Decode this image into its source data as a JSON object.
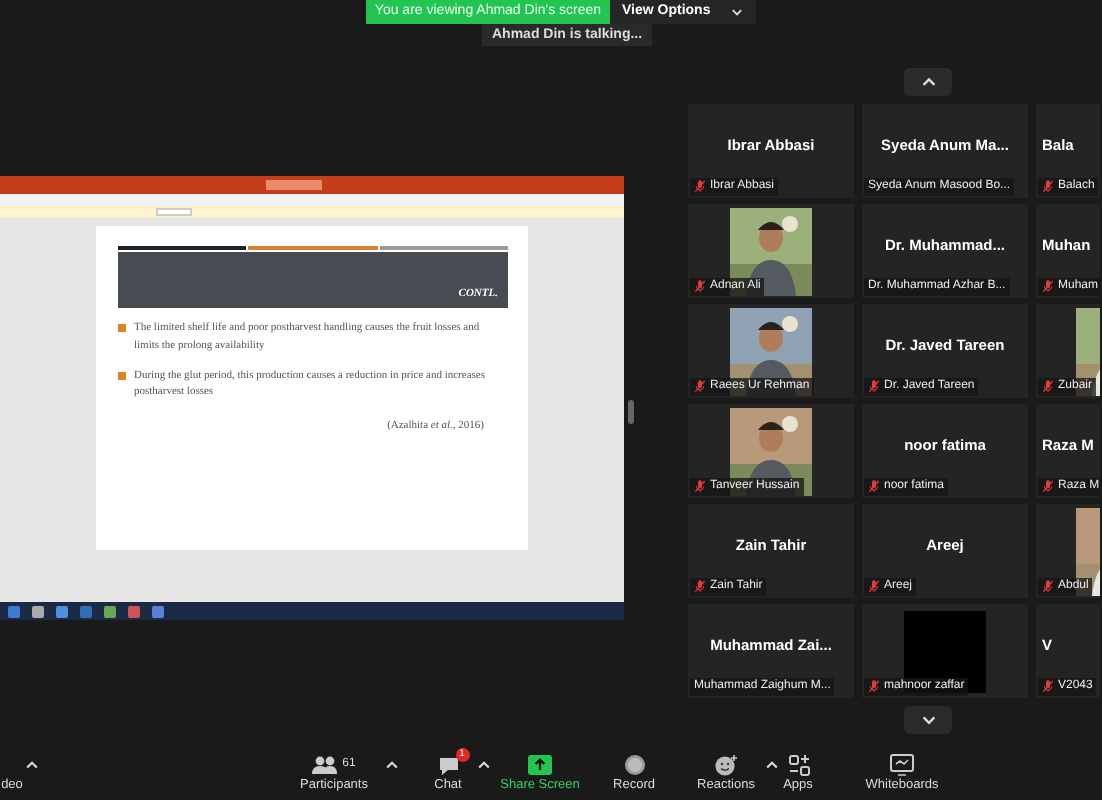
{
  "banner": {
    "text": "You are viewing Ahmad Din's screen",
    "view_options": "View Options",
    "talking": "Ahmad Din is talking..."
  },
  "shared_screen": {
    "slide": {
      "heading": "CONTL.",
      "bullets": [
        "The limited shelf life and poor postharvest handling causes the fruit losses and limits the prolong availability",
        "During the glut period, this production causes a reduction in price and increases postharvest losses"
      ],
      "citation": "(Azalhita *et al.*, 2016)"
    }
  },
  "gallery": {
    "tiles": [
      {
        "kind": "name",
        "display_name": "Ibrar Abbasi",
        "label": "Ibrar Abbasi",
        "muted": true
      },
      {
        "kind": "name",
        "display_name": "Syeda Anum Ma...",
        "label": "Syeda Anum Masood Bo...",
        "muted": false
      },
      {
        "kind": "name",
        "display_name": "Bala",
        "label": "Balach",
        "muted": true
      },
      {
        "kind": "picture",
        "label": "Adnan Ali",
        "muted": true
      },
      {
        "kind": "name",
        "display_name": "Dr. Muhammad...",
        "label": "Dr. Muhammad Azhar B...",
        "muted": false
      },
      {
        "kind": "name",
        "display_name": "Muhan",
        "label": "Muham",
        "muted": true
      },
      {
        "kind": "picture",
        "label": "Raees Ur Rehman",
        "muted": true
      },
      {
        "kind": "name",
        "display_name": "Dr. Javed Tareen",
        "label": "Dr. Javed Tareen",
        "muted": true
      },
      {
        "kind": "picture",
        "label": "Zubair",
        "muted": true
      },
      {
        "kind": "picture",
        "label": "Tanveer Hussain",
        "muted": true
      },
      {
        "kind": "name",
        "display_name": "noor fatima",
        "label": "noor fatima",
        "muted": true
      },
      {
        "kind": "name",
        "display_name": "Raza M",
        "label": "Raza M",
        "muted": true
      },
      {
        "kind": "name",
        "display_name": "Zain Tahir",
        "label": "Zain Tahir",
        "muted": true
      },
      {
        "kind": "name",
        "display_name": "Areej",
        "label": "Areej",
        "muted": true
      },
      {
        "kind": "picture",
        "label": "Abdul",
        "muted": true
      },
      {
        "kind": "name",
        "display_name": "Muhammad  Zai...",
        "label": "Muhammad Zaighum M...",
        "muted": false
      },
      {
        "kind": "black",
        "label": "mahnoor zaffar",
        "muted": true
      },
      {
        "kind": "name",
        "display_name": "V",
        "label": "V2043",
        "muted": true
      }
    ]
  },
  "toolbar": {
    "items": [
      {
        "kind": "video",
        "label": "deo",
        "caret": true
      },
      {
        "kind": "participants",
        "label": "Participants",
        "count": "61",
        "caret": true
      },
      {
        "kind": "chat",
        "label": "Chat",
        "badge": "1",
        "caret": true
      },
      {
        "kind": "share",
        "label": "Share Screen",
        "caret": false
      },
      {
        "kind": "record",
        "label": "Record",
        "caret": false
      },
      {
        "kind": "reactions",
        "label": "Reactions",
        "caret": true
      },
      {
        "kind": "apps",
        "label": "Apps",
        "caret": false
      },
      {
        "kind": "whiteboards",
        "label": "Whiteboards",
        "caret": false
      }
    ]
  }
}
